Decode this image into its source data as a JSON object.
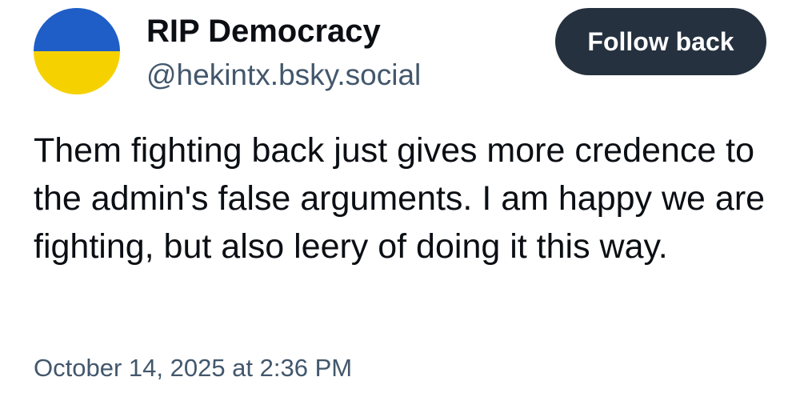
{
  "author": {
    "display_name": "RIP Democracy",
    "handle": "@hekintx.bsky.social",
    "avatar_icon": "ukraine-flag-avatar-icon",
    "avatar_colors": {
      "top": "#1f5ec7",
      "bottom": "#f6d100"
    }
  },
  "follow_button": {
    "label": "Follow back",
    "background": "#25313f",
    "text_color": "#ffffff"
  },
  "post": {
    "text": "Them fighting back just gives more credence to the admin's false arguments. I am happy we are fighting, but also leery of doing it this way.",
    "timestamp": "October 14, 2025 at 2:36 PM"
  }
}
